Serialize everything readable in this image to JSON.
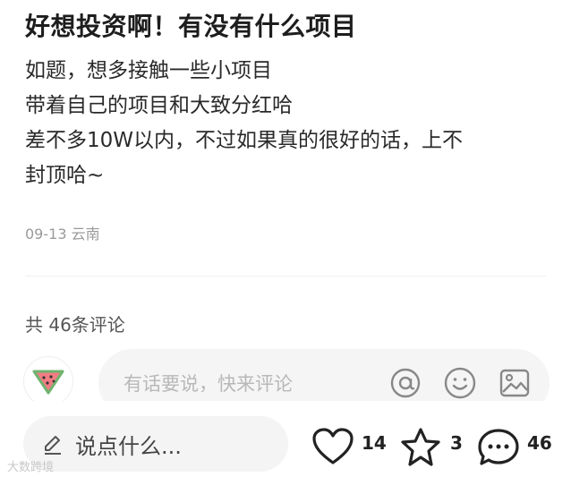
{
  "post": {
    "title": "好想投资啊！有没有什么项目",
    "body_lines": [
      "如题，想多接触一些小项目",
      "带着自己的项目和大致分红哈",
      "差不多10W以内，不过如果真的很好的话，上不",
      "封顶哈~"
    ],
    "date": "09-13",
    "location": "云南"
  },
  "comments": {
    "count_label": "共 46条评论",
    "input_placeholder": "有话要说，快来评论"
  },
  "bottom": {
    "say_label": "说点什么...",
    "likes": "14",
    "stars": "3",
    "comments": "46"
  },
  "watermark": "大数跨境",
  "icons": {
    "avatar": "watermelon-icon",
    "at": "at-icon",
    "emoji": "emoji-icon",
    "image": "image-icon",
    "pen": "pen-icon",
    "heart": "heart-icon",
    "star": "star-icon",
    "comment": "comment-icon"
  }
}
